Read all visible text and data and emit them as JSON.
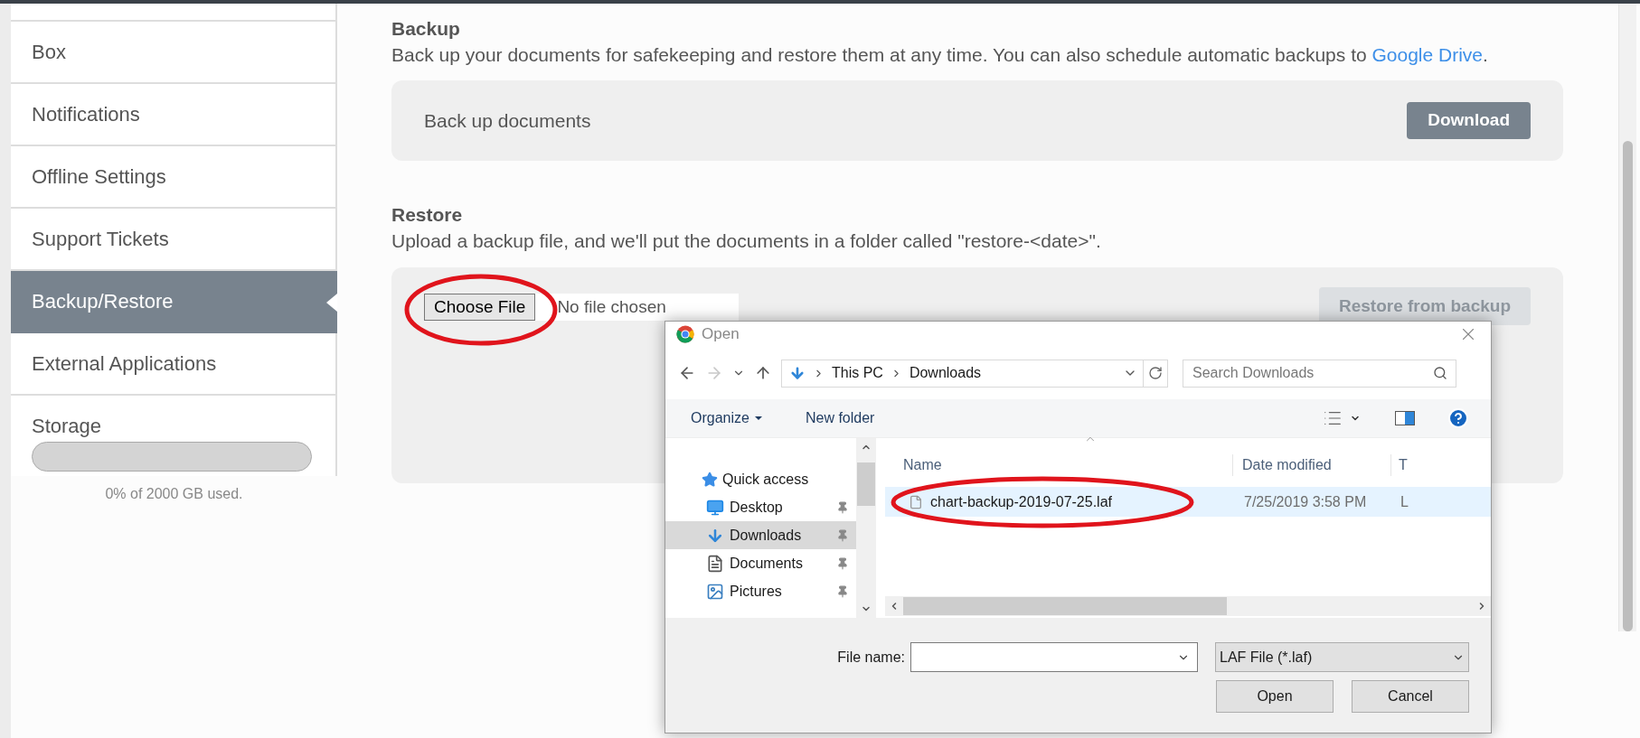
{
  "sidebar": {
    "items": [
      {
        "label": "Box",
        "selected": false
      },
      {
        "label": "Notifications",
        "selected": false
      },
      {
        "label": "Offline Settings",
        "selected": false
      },
      {
        "label": "Support Tickets",
        "selected": false
      },
      {
        "label": "Backup/Restore",
        "selected": true
      },
      {
        "label": "External Applications",
        "selected": false
      }
    ],
    "storage": {
      "label": "Storage",
      "level": 0,
      "usage": "0% of 2000 GB used."
    }
  },
  "backup": {
    "title": "Backup",
    "description": "Back up your documents for safekeeping and restore them at any time. You can also schedule automatic backups to ",
    "link": "Google Drive",
    "description_end": ".",
    "card_label": "Back up documents",
    "button": "Download"
  },
  "restore": {
    "title": "Restore",
    "description": "Upload a backup file, and we'll put the documents in a folder called \"restore-<date>\".",
    "choose_button": "Choose File",
    "file_status": "No file chosen",
    "restore_button": {
      "label": "Restore from backup",
      "disabled": true
    }
  },
  "dialog": {
    "title": "Open",
    "breadcrumb": [
      "This PC",
      "Downloads"
    ],
    "search_placeholder": "Search Downloads",
    "organize": "Organize",
    "new_folder": "New folder",
    "nav_pane": [
      {
        "label": "Quick access",
        "kind": "star",
        "selected": false,
        "children": [
          {
            "label": "Desktop",
            "kind": "desktop",
            "selected": false
          },
          {
            "label": "Downloads",
            "kind": "downloads",
            "selected": true
          },
          {
            "label": "Documents",
            "kind": "documents",
            "selected": false
          },
          {
            "label": "Pictures",
            "kind": "pictures",
            "selected": false
          }
        ]
      }
    ],
    "columns": [
      "Name",
      "Date modified",
      "T"
    ],
    "files": [
      {
        "name": "chart-backup-2019-07-25.laf",
        "date": "7/25/2019 3:58 PM",
        "column_3": "L",
        "selected": true
      }
    ],
    "file_name_label": "File name:",
    "file_type": "LAF File (*.laf)",
    "buttons": [
      "Open",
      "Cancel"
    ]
  }
}
